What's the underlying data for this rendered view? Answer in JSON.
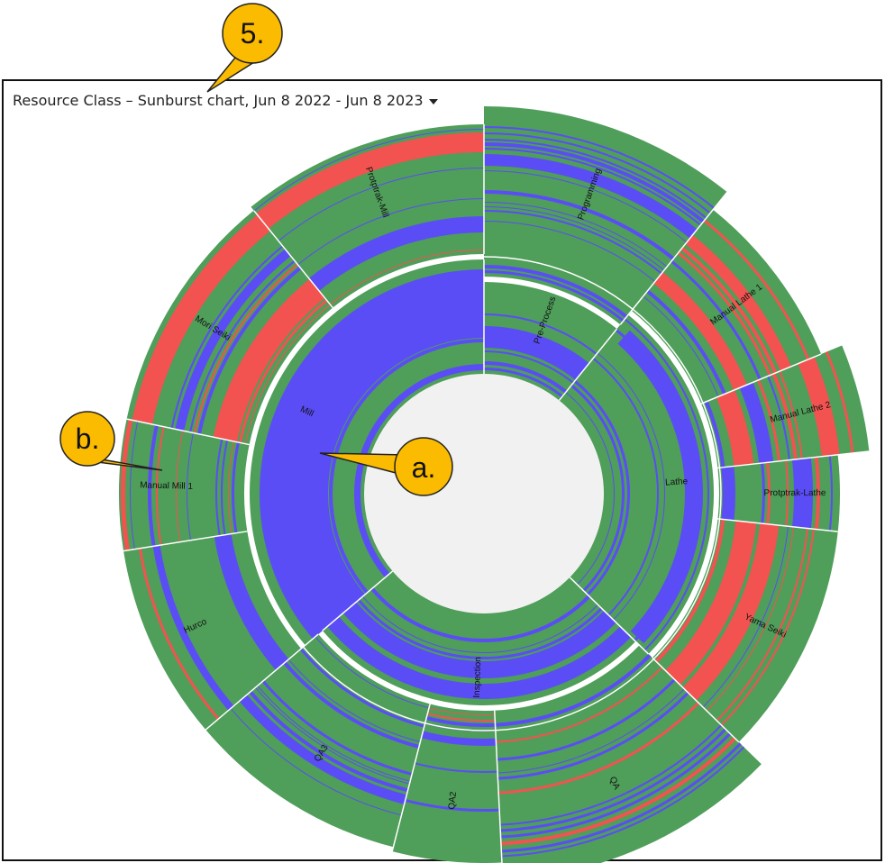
{
  "header": {
    "title": "Resource Class – Sunburst chart, Jun 8 2022 - Jun 8 2023"
  },
  "callouts": [
    {
      "id": "5",
      "label": "5."
    },
    {
      "id": "a",
      "label": "a."
    },
    {
      "id": "b",
      "label": "b."
    }
  ],
  "colors": {
    "green": "#4f9e5a",
    "blue": "#5a4df6",
    "red": "#f25350",
    "center": "#f1f1f1",
    "callout_fill": "#fbbb00",
    "callout_stroke": "#222222"
  },
  "chart_data": {
    "type": "sunburst",
    "title": "Resource Class – Sunburst chart, Jun 8 2022 - Jun 8 2023",
    "start_at": "12 o'clock, clockwise",
    "categories": [
      {
        "name": "Pre-Process",
        "share": 0.108,
        "children": [
          {
            "name": "Programming",
            "share": 1.0
          }
        ]
      },
      {
        "name": "Lathe",
        "share": 0.265,
        "children": [
          {
            "name": "Manual Lathe 1",
            "share": 0.3
          },
          {
            "name": "Manual Lathe 2",
            "share": 0.17
          },
          {
            "name": "Protptrak-Lathe",
            "share": 0.13
          },
          {
            "name": "Yama Seiki",
            "share": 0.4
          }
        ]
      },
      {
        "name": "Inspection",
        "share": 0.265,
        "children": [
          {
            "name": "QA",
            "share": 0.45
          },
          {
            "name": "QA2",
            "share": 0.18
          },
          {
            "name": "QA3",
            "share": 0.37
          }
        ]
      },
      {
        "name": "Mill",
        "share": 0.362,
        "children": [
          {
            "name": "Hurco",
            "share": 0.24
          },
          {
            "name": "Manual Mill 1",
            "share": 0.16
          },
          {
            "name": "Mori Seiki",
            "share": 0.3
          },
          {
            "name": "Protptrak-Mill",
            "share": 0.3
          }
        ]
      }
    ],
    "band_colors": [
      "green",
      "blue",
      "red"
    ]
  }
}
